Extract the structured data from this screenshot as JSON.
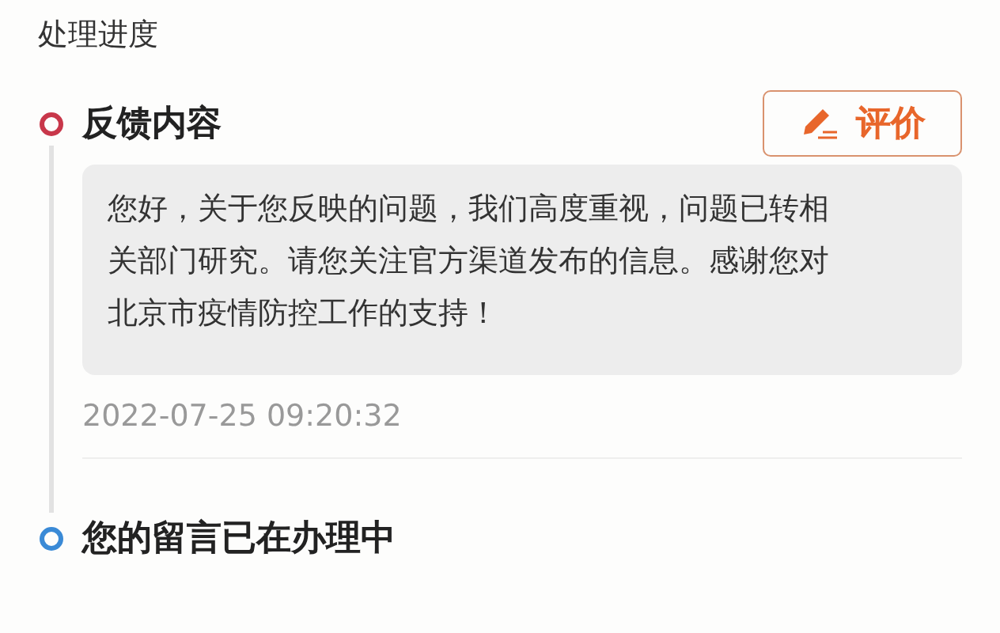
{
  "header": {
    "title": "处理进度"
  },
  "steps": [
    {
      "title": "反馈内容",
      "color": "#c8374a",
      "action": {
        "label": "评价"
      },
      "message": "您好，关于您反映的问题，我们高度重视，问题已转相关部门研究。请您关注官方渠道发布的信息。感谢您对北京市疫情防控工作的支持！",
      "time": "2022-07-25 09:20:32"
    },
    {
      "title": "您的留言已在办理中",
      "color": "#3a8ad6"
    }
  ]
}
